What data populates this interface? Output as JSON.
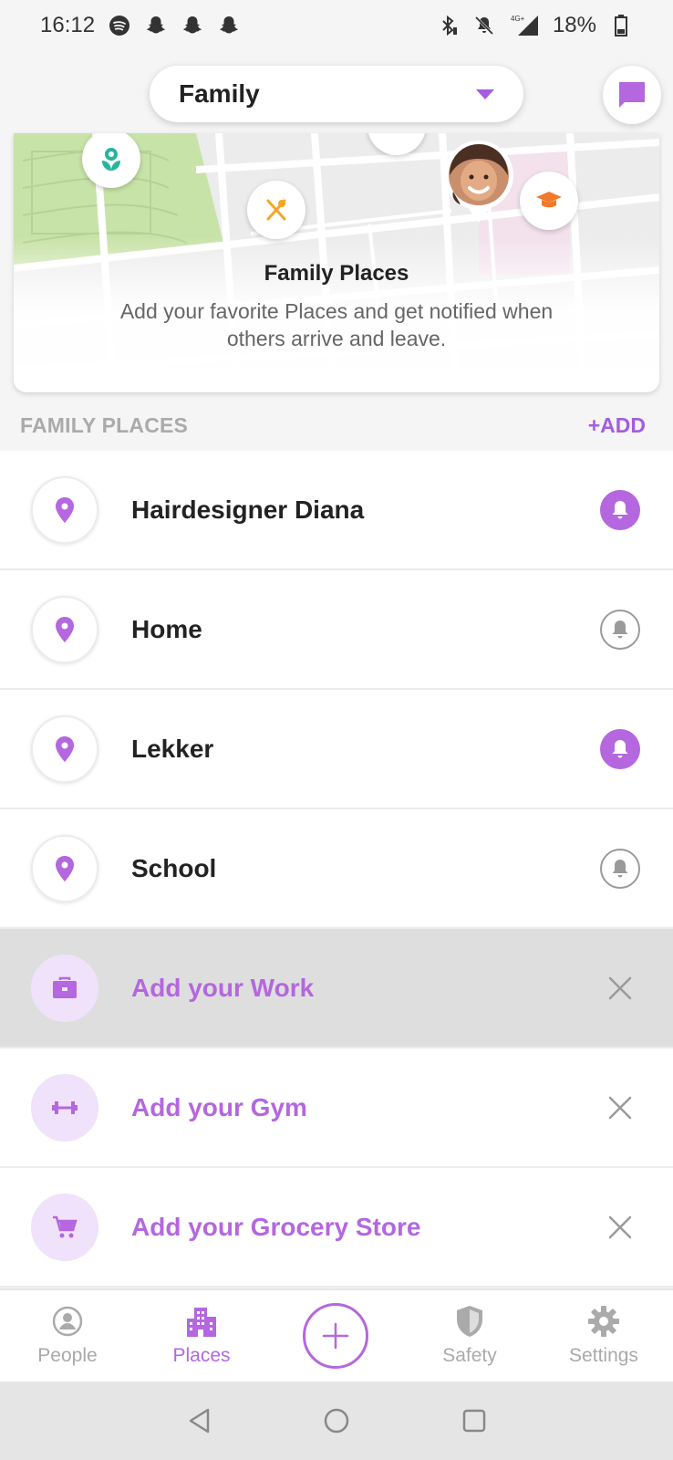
{
  "status_bar": {
    "time": "16:12",
    "battery": "18%",
    "network": "4G+",
    "left_icons": [
      "spotify-icon",
      "snapchat-icon",
      "snapchat-icon",
      "snapchat-icon"
    ],
    "right_icons": [
      "bluetooth-icon",
      "mute-icon",
      "signal-icon",
      "battery-icon"
    ]
  },
  "header": {
    "circle_name": "Family",
    "chat_icon": "chat-icon"
  },
  "map_card": {
    "title": "Family Places",
    "description": "Add your favorite Places and get notified when others arrive and leave."
  },
  "places_section": {
    "title": "FAMILY PLACES",
    "add_label": "+ADD"
  },
  "places": [
    {
      "name": "Hairdesigner Diana",
      "icon": "location-pin-icon",
      "notifications": "on"
    },
    {
      "name": "Home",
      "icon": "location-pin-icon",
      "notifications": "off"
    },
    {
      "name": "Lekker",
      "icon": "location-pin-icon",
      "notifications": "on"
    },
    {
      "name": "School",
      "icon": "location-pin-icon",
      "notifications": "off"
    }
  ],
  "suggestions": [
    {
      "label": "Add your Work",
      "icon": "briefcase-icon"
    },
    {
      "label": "Add your Gym",
      "icon": "dumbbell-icon"
    },
    {
      "label": "Add your Grocery Store",
      "icon": "shopping-cart-icon"
    }
  ],
  "tabs": [
    {
      "label": "People",
      "icon": "person-icon",
      "active": false
    },
    {
      "label": "Places",
      "icon": "buildings-icon",
      "active": true
    },
    {
      "label": "Safety",
      "icon": "shield-icon",
      "active": false
    },
    {
      "label": "Settings",
      "icon": "gear-icon",
      "active": false
    }
  ],
  "colors": {
    "accent": "#b467df",
    "accent_light": "#f0e2fa",
    "muted_text": "#aaaaaa",
    "map_green": "#c8e3a8",
    "pin_teal": "#26b5a0",
    "pin_orange": "#f07a2a",
    "pin_yellow": "#f5a623"
  }
}
